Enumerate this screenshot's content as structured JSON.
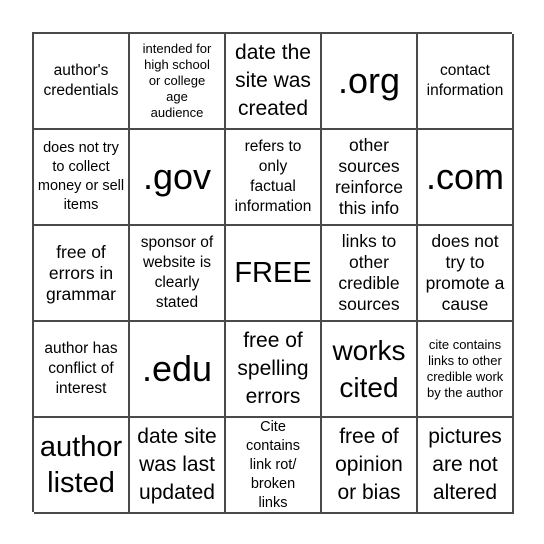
{
  "board": {
    "cells": [
      "author's credentials",
      "intended for high school or college age audience",
      "date the site was created",
      ".org",
      "contact information",
      "does not try to collect money or sell items",
      ".gov",
      "refers to only factual information",
      "other sources reinforce this info",
      ".com",
      "free of errors in grammar",
      "sponsor of website is clearly stated",
      "FREE",
      "links to other credible sources",
      "does not try to promote a cause",
      "author has conflict of interest",
      ".edu",
      "free of spelling errors",
      "works cited",
      "cite contains links to other credible work by the author",
      "author listed",
      "date site was last updated",
      "Cite contains link rot/ broken links",
      "free of opinion or bias",
      "pictures are not altered"
    ]
  }
}
